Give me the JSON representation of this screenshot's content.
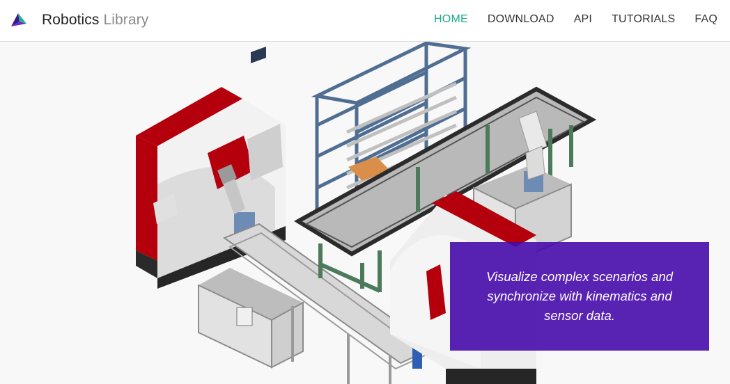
{
  "brand": {
    "name_primary": "Robotics",
    "name_secondary": "Library",
    "logo_icon": "rl-logo-icon",
    "colors": {
      "accent": "#1aaa8b",
      "purple": "#4b1fa0",
      "teal": "#1fb38f"
    }
  },
  "nav": {
    "items": [
      {
        "label": "HOME",
        "active": true
      },
      {
        "label": "DOWNLOAD",
        "active": false
      },
      {
        "label": "API",
        "active": false
      },
      {
        "label": "TUTORIALS",
        "active": false
      },
      {
        "label": "FAQ",
        "active": false
      }
    ]
  },
  "hero": {
    "caption": {
      "line1": "Visualize complex scenarios and",
      "line2": "synchronize with kinematics and",
      "line3": "sensor data."
    },
    "caption_bg": "#4b12a8"
  }
}
